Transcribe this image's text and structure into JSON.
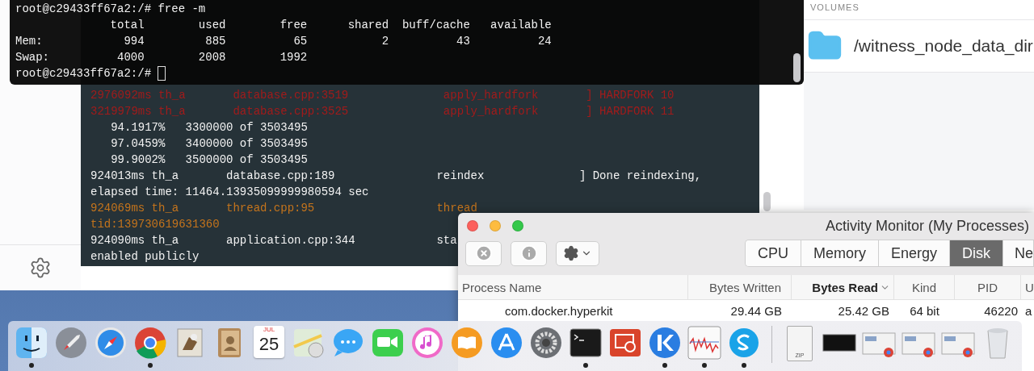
{
  "front_terminal": {
    "lines": [
      {
        "kind": "prompt",
        "text": "root@c29433ff67a2:/# free -m"
      },
      {
        "kind": "output",
        "text": "              total        used        free      shared  buff/cache   available"
      },
      {
        "kind": "output",
        "text": "Mem:            994         885          65           2          43          24"
      },
      {
        "kind": "output",
        "text": "Swap:          4000        2008        1992"
      },
      {
        "kind": "cursor",
        "text": "root@c29433ff67a2:/# "
      }
    ]
  },
  "back_terminal": {
    "lines": [
      {
        "kind": "error",
        "text": "2976092ms th_a       database.cpp:3519              apply_hardfork       ] HARDFORK 10"
      },
      {
        "kind": "error",
        "text": "3219979ms th_a       database.cpp:3525              apply_hardfork       ] HARDFORK 11"
      },
      {
        "kind": "info",
        "text": "   94.1917%   3300000 of 3503495"
      },
      {
        "kind": "info",
        "text": "   97.0459%   3400000 of 3503495"
      },
      {
        "kind": "info",
        "text": "   99.9002%   3500000 of 3503495"
      },
      {
        "kind": "info",
        "text": "924013ms th_a       database.cpp:189               reindex              ] Done reindexing,"
      },
      {
        "kind": "info",
        "text": "elapsed time: 11464.13935099999980594 sec"
      },
      {
        "kind": "warning",
        "text": "924069ms th_a       thread.cpp:95                  thread"
      },
      {
        "kind": "warning",
        "text": "tid:139730619631360"
      },
      {
        "kind": "info",
        "text": "924090ms th_a       application.cpp:344            sta"
      },
      {
        "kind": "info",
        "text": "enabled publicly"
      }
    ]
  },
  "volumes_panel": {
    "heading": "VOLUMES",
    "items": [
      {
        "path": "/witness_node_data_dir"
      }
    ]
  },
  "activity_monitor": {
    "title": "Activity Monitor (My Processes)",
    "tabs": [
      {
        "label": "CPU",
        "selected": false
      },
      {
        "label": "Memory",
        "selected": false
      },
      {
        "label": "Energy",
        "selected": false
      },
      {
        "label": "Disk",
        "selected": true
      },
      {
        "label": "Ne",
        "selected": false
      }
    ],
    "columns": [
      {
        "label": "Process Name",
        "sorted": false
      },
      {
        "label": "Bytes Written",
        "sorted": false
      },
      {
        "label": "Bytes Read",
        "sorted": true
      },
      {
        "label": "Kind",
        "sorted": false
      },
      {
        "label": "PID",
        "sorted": false
      },
      {
        "label": "U",
        "sorted": false
      }
    ],
    "rows": [
      {
        "cells": [
          "com.docker.hyperkit",
          "29.44 GB",
          "25.42 GB",
          "64 bit",
          "46220",
          "a"
        ]
      }
    ]
  },
  "dock": {
    "items": [
      {
        "kind": "finder",
        "running": true
      },
      {
        "kind": "launchpad",
        "running": false
      },
      {
        "kind": "safari",
        "running": false
      },
      {
        "kind": "chrome",
        "running": true
      },
      {
        "kind": "mail",
        "running": false
      },
      {
        "kind": "contacts",
        "running": false
      },
      {
        "kind": "calendar",
        "running": false,
        "month": "JUL",
        "day": "25"
      },
      {
        "kind": "maps",
        "running": false
      },
      {
        "kind": "messages",
        "running": false
      },
      {
        "kind": "facetime",
        "running": false
      },
      {
        "kind": "music",
        "running": false
      },
      {
        "kind": "books",
        "running": false
      },
      {
        "kind": "appstore",
        "running": false
      },
      {
        "kind": "settings",
        "running": false
      },
      {
        "kind": "terminal",
        "running": true
      },
      {
        "kind": "remote",
        "running": false
      },
      {
        "kind": "kitematic",
        "running": true
      },
      {
        "kind": "monitor",
        "running": true
      },
      {
        "kind": "skype",
        "running": true
      },
      {
        "kind": "separator"
      },
      {
        "kind": "zip",
        "running": false,
        "label": "ZIP"
      },
      {
        "kind": "thumb_dark",
        "running": false
      },
      {
        "kind": "thumb_browser",
        "running": false
      },
      {
        "kind": "thumb_browser",
        "running": false
      },
      {
        "kind": "thumb_browser",
        "running": false
      },
      {
        "kind": "trash",
        "running": false
      }
    ]
  }
}
